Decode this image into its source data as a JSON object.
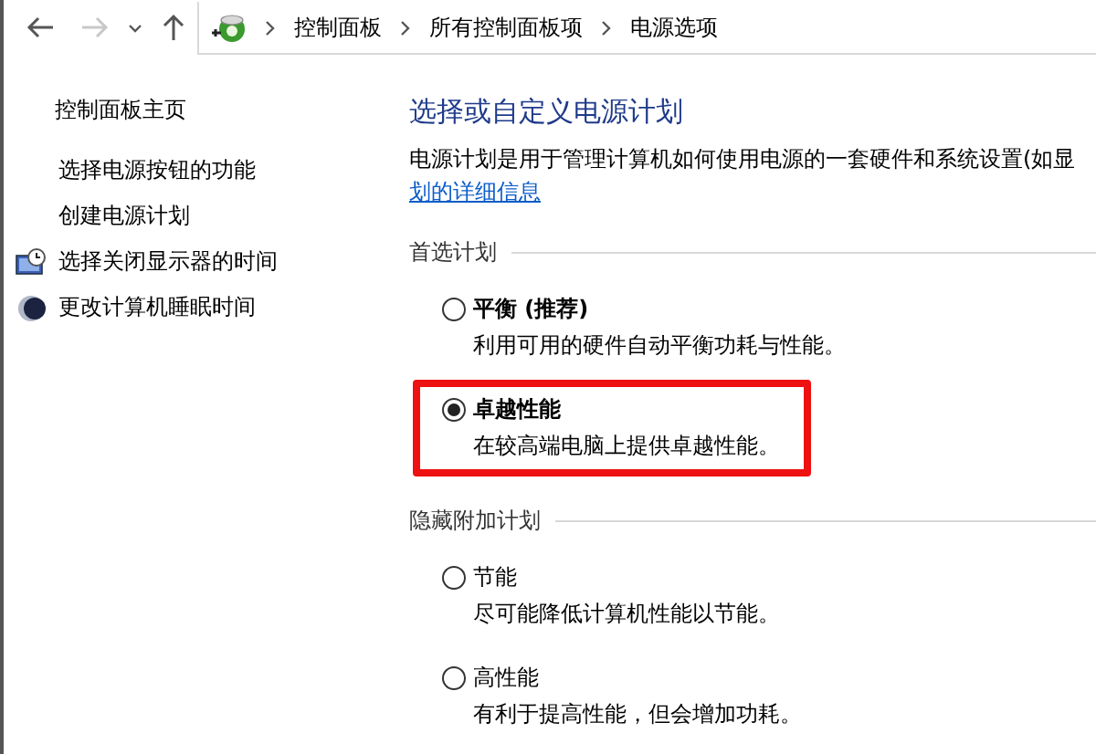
{
  "nav_buttons": [
    {
      "kind": "back",
      "disabled": false
    },
    {
      "kind": "forward",
      "disabled": true
    },
    {
      "kind": "recent",
      "disabled": false
    },
    {
      "kind": "up",
      "disabled": false
    }
  ],
  "breadcrumb": [
    "控制面板",
    "所有控制面板项",
    "电源选项"
  ],
  "sidebar": {
    "home": "控制面板主页",
    "items": [
      {
        "label": "选择电源按钮的功能",
        "kind": "plain"
      },
      {
        "label": "创建电源计划",
        "kind": "plain"
      },
      {
        "label": "选择关闭显示器的时间",
        "kind": "monitor"
      },
      {
        "label": "更改计算机睡眠时间",
        "kind": "sleep"
      }
    ]
  },
  "main": {
    "title": "选择或自定义电源计划",
    "description": "电源计划是用于管理计算机如何使用电源的一套硬件和系统设置(如显",
    "link": "划的详细信息",
    "groups": [
      {
        "heading": "首选计划",
        "plans": [
          {
            "name": "平衡 (推荐)",
            "description": "利用可用的硬件自动平衡功耗与性能。",
            "selected": false,
            "highlighted": false
          },
          {
            "name": "卓越性能",
            "description": "在较高端电脑上提供卓越性能。",
            "selected": true,
            "highlighted": true
          }
        ]
      },
      {
        "heading": "隐藏附加计划",
        "plans": [
          {
            "name": "节能",
            "description": "尽可能降低计算机性能以节能。",
            "selected": false,
            "highlighted": false
          },
          {
            "name": "高性能",
            "description": "有利于提高性能，但会增加功耗。",
            "selected": false,
            "highlighted": false
          }
        ]
      }
    ]
  }
}
